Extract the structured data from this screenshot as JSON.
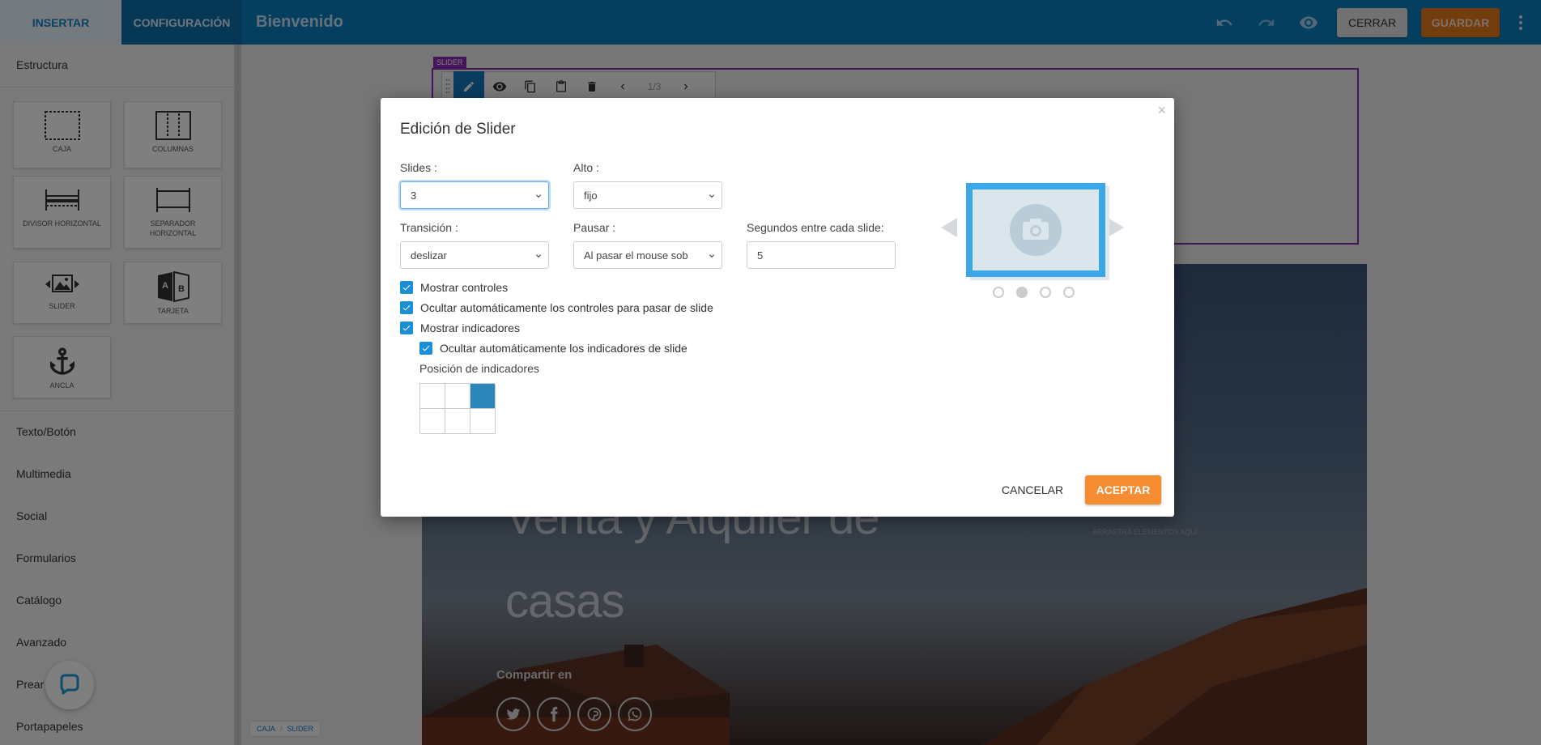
{
  "header": {
    "tab_insert": "INSERTAR",
    "tab_config": "CONFIGURACIÓN",
    "title": "Bienvenido",
    "close_label": "CERRAR",
    "save_label": "GUARDAR",
    "icons": [
      "undo-icon",
      "redo-icon",
      "eye-icon",
      "more-vert-icon"
    ]
  },
  "sidebar": {
    "section_title": "Estructura",
    "tiles": [
      {
        "label": "CAJA",
        "icon": "box-icon"
      },
      {
        "label": "COLUMNAS",
        "icon": "columns-icon"
      },
      {
        "label": "DIVISOR HORIZONTAL",
        "icon": "horizontal-divider-icon"
      },
      {
        "label": "SEPARADOR HORIZONTAL",
        "icon": "horizontal-separator-icon"
      },
      {
        "label": "SLIDER",
        "icon": "slider-icon"
      },
      {
        "label": "TARJETA",
        "icon": "card-icon"
      },
      {
        "label": "ANCLA",
        "icon": "anchor-icon"
      }
    ],
    "categories": [
      "Texto/Botón",
      "Multimedia",
      "Social",
      "Formularios",
      "Catálogo",
      "Avanzado",
      "Prear",
      "Portapapeles"
    ]
  },
  "canvas": {
    "slider_tag": "SLIDER",
    "pager": "1/3",
    "hero_line1": "Venta y Alquiler de",
    "hero_line2": "casas",
    "share_label": "Compartir en",
    "drag_hint": "ARRASTRA ELEMENTOS AQUÍ",
    "breadcrumb": [
      "CAJA",
      "SLIDER"
    ]
  },
  "modal": {
    "title": "Edición de Slider",
    "close": "×",
    "slides_label": "Slides :",
    "slides_value": "3",
    "alto_label": "Alto :",
    "alto_value": "fijo",
    "transicion_label": "Transición :",
    "transicion_value": "deslizar",
    "pausar_label": "Pausar :",
    "pausar_value": "Al pasar el mouse sob",
    "segundos_label": "Segundos entre cada slide:",
    "segundos_value": "5",
    "chk_mostrar_controles": "Mostrar controles",
    "chk_ocultar_controles": "Ocultar automáticamente los controles para pasar de slide",
    "chk_mostrar_indicadores": "Mostrar indicadores",
    "chk_ocultar_indicadores": "Ocultar automáticamente los indicadores de slide",
    "posicion_label": "Posición de indicadores",
    "selected_position": "top-right",
    "cancel_label": "CANCELAR",
    "accept_label": "ACEPTAR"
  },
  "colors": {
    "header_blue": "#0b7fc0",
    "save_orange": "#e4781b",
    "accept_orange": "#f58c32",
    "slider_purple": "#8a2bb5",
    "checkbox_blue": "#1a8fd6"
  }
}
